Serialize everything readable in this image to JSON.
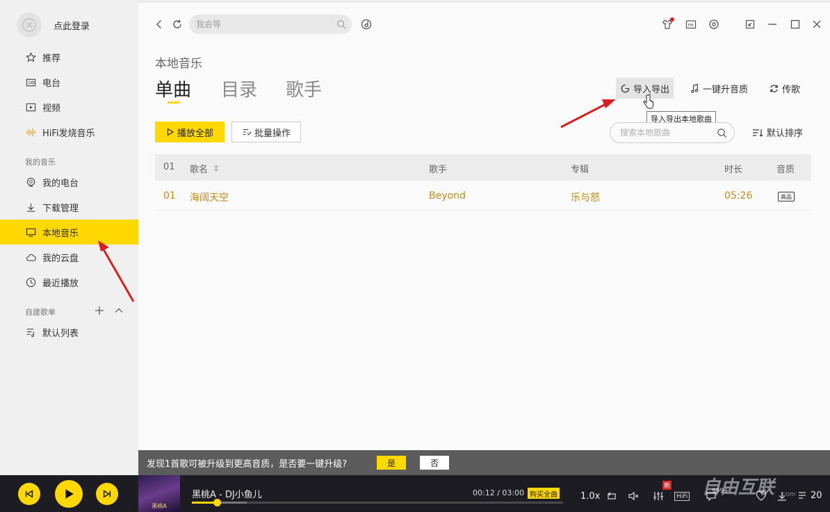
{
  "sidebar": {
    "login_text": "点此登录",
    "items": [
      {
        "label": "推荐"
      },
      {
        "label": "电台"
      },
      {
        "label": "视频"
      },
      {
        "label": "HiFi发烧音乐"
      },
      {
        "label": "我的电台"
      },
      {
        "label": "下载管理"
      },
      {
        "label": "本地音乐"
      },
      {
        "label": "我的云盘"
      },
      {
        "label": "最近播放"
      },
      {
        "label": "默认列表"
      }
    ],
    "section_my_music": "我的音乐",
    "section_playlists": "自建歌单",
    "active_item": "本地音乐"
  },
  "topbar": {
    "search_placeholder": "我会等"
  },
  "main": {
    "page_title": "本地音乐",
    "tabs": [
      {
        "label": "单曲",
        "active": true
      },
      {
        "label": "目录",
        "active": false
      },
      {
        "label": "歌手",
        "active": false
      }
    ],
    "actions": {
      "import_export": "导入导出",
      "upgrade_quality": "一键升音质",
      "upload": "传歌"
    },
    "tooltip": "导入导出本地歌曲",
    "play_all": "播放全部",
    "batch": "批量操作",
    "local_search_placeholder": "搜索本地歌曲",
    "sort": "默认排序",
    "table": {
      "headers": {
        "index": "01",
        "name": "歌名",
        "artist": "歌手",
        "album": "专辑",
        "duration": "时长",
        "quality": "音质"
      },
      "rows": [
        {
          "index": "01",
          "name": "海阔天空",
          "artist": "Beyond",
          "album": "乐与怒",
          "duration": "05:26",
          "quality": "高品"
        }
      ]
    }
  },
  "upgrade_bar": {
    "message": "发现1首歌可被升级到更高音质，是否要一键升级?",
    "yes": "是",
    "no": "否"
  },
  "player": {
    "album_art_text": "黑桃A",
    "song": "黑桃A - DJ小鱼儿",
    "current_time": "00:12",
    "total_time": "03:00",
    "time_text": "00:12 / 03:00",
    "progress_fraction": 0.067,
    "buy_label": "购买全曲",
    "speed": "1.0x",
    "new_badge": "新",
    "hifi_badge": "HiFi",
    "comment_count": "999+",
    "list_count": "20"
  },
  "watermark": {
    "text": "自由互联",
    "sub": ".com"
  },
  "colors": {
    "accent": "#ffd800",
    "row_text": "#c08b1a",
    "player_bg": "#1c1c22"
  }
}
